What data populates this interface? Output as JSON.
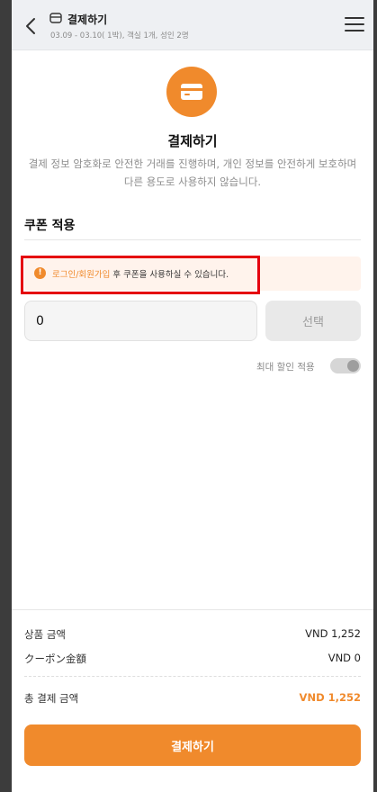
{
  "header": {
    "title": "결제하기",
    "subtitle": "03.09 - 03.10( 1박), 객실 1개, 성인 2명"
  },
  "main": {
    "title": "결제하기",
    "description": "결제 정보 암호화로 안전한 거래를 진행하며, 개인 정보를 안전하게 보호하며 다른 용도로 사용하지 않습니다."
  },
  "coupon": {
    "section_title": "쿠폰 적용",
    "notice_link": "로그인/회원가입",
    "notice_text": " 후 쿠폰을 사용하실 수 있습니다.",
    "input_value": "0",
    "select_label": "선택",
    "max_discount_label": "최대 할인 적용",
    "max_discount_enabled": false
  },
  "summary": {
    "product_label": "상품 금액",
    "product_value": "VND 1,252",
    "coupon_label": "クーポン金額",
    "coupon_value": "VND 0",
    "total_label": "총 결제 금액",
    "total_value": "VND 1,252"
  },
  "pay_button_label": "결제하기",
  "colors": {
    "accent": "#f08a2c",
    "highlight_border": "#e5000f",
    "notice_bg": "#fff3ec"
  },
  "icons": {
    "back": "chevron-left-icon",
    "header": "credit-card-icon",
    "menu": "hamburger-menu-icon",
    "payment": "credit-card-icon",
    "warning": "exclamation-circle-icon"
  }
}
